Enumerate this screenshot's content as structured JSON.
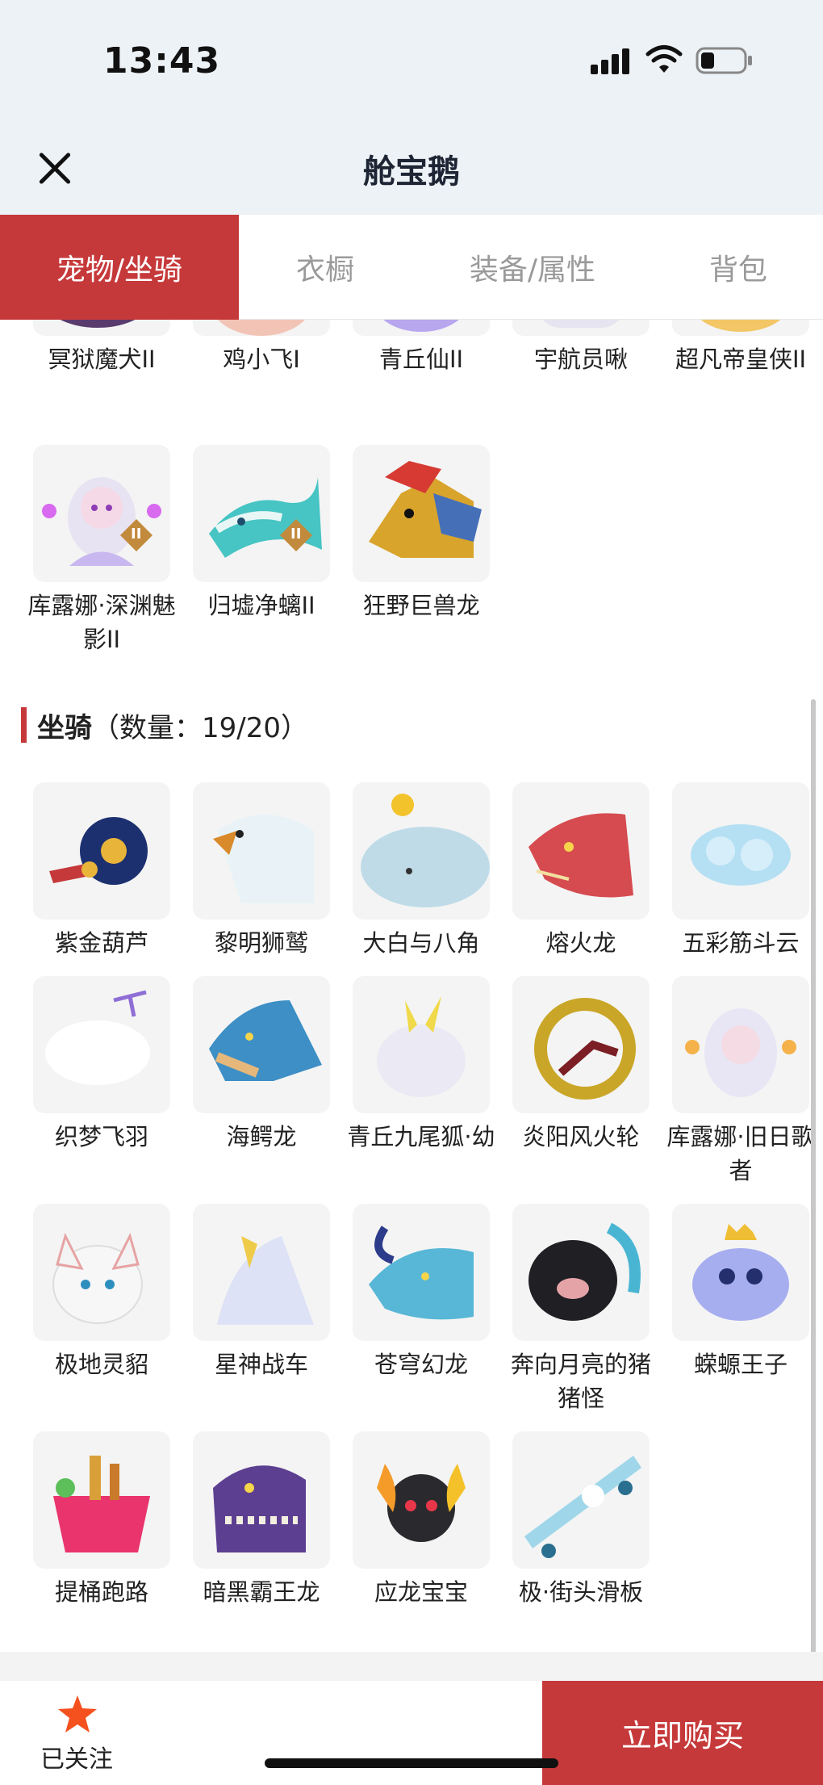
{
  "status": {
    "time": "13:43",
    "icons": [
      "signal-icon",
      "wifi-icon",
      "battery-icon"
    ]
  },
  "header": {
    "title": "舱宝鹅",
    "close_icon": "close-icon"
  },
  "tabs": [
    {
      "label": "宠物/坐骑",
      "active": true
    },
    {
      "label": "衣橱",
      "active": false
    },
    {
      "label": "装备/属性",
      "active": false
    },
    {
      "label": "背包",
      "active": false
    }
  ],
  "pets_partial": [
    {
      "name": "冥狱魔犬II"
    },
    {
      "name": "鸡小飞I"
    },
    {
      "name": "青丘仙II"
    },
    {
      "name": "宇航员啾"
    },
    {
      "name": "超凡帝皇侠II"
    }
  ],
  "pets": [
    {
      "name": "库露娜·深渊魅影II",
      "badge": "II"
    },
    {
      "name": "归墟净螭II",
      "badge": "II"
    },
    {
      "name": "狂野巨兽龙"
    }
  ],
  "mounts_section": {
    "title": "坐骑",
    "count_text": "（数量：19/20）"
  },
  "mounts": [
    {
      "name": "紫金葫芦"
    },
    {
      "name": "黎明狮鹫"
    },
    {
      "name": "大白与八角"
    },
    {
      "name": "熔火龙"
    },
    {
      "name": "五彩筋斗云"
    },
    {
      "name": "织梦飞羽"
    },
    {
      "name": "海鳄龙"
    },
    {
      "name": "青丘九尾狐·幼"
    },
    {
      "name": "炎阳风火轮"
    },
    {
      "name": "库露娜·旧日歌者"
    },
    {
      "name": "极地灵貂"
    },
    {
      "name": "星神战车"
    },
    {
      "name": "苍穹幻龙"
    },
    {
      "name": "奔向月亮的猪猪怪"
    },
    {
      "name": "蝾螈王子"
    },
    {
      "name": "提桶跑路"
    },
    {
      "name": "暗黑霸王龙"
    },
    {
      "name": "应龙宝宝"
    },
    {
      "name": "极·街头滑板"
    }
  ],
  "bottom": {
    "follow_label": "已关注",
    "follow_icon": "star-icon",
    "buy_label": "立即购买"
  },
  "colors": {
    "accent": "#c6393a",
    "star": "#f4511e"
  }
}
